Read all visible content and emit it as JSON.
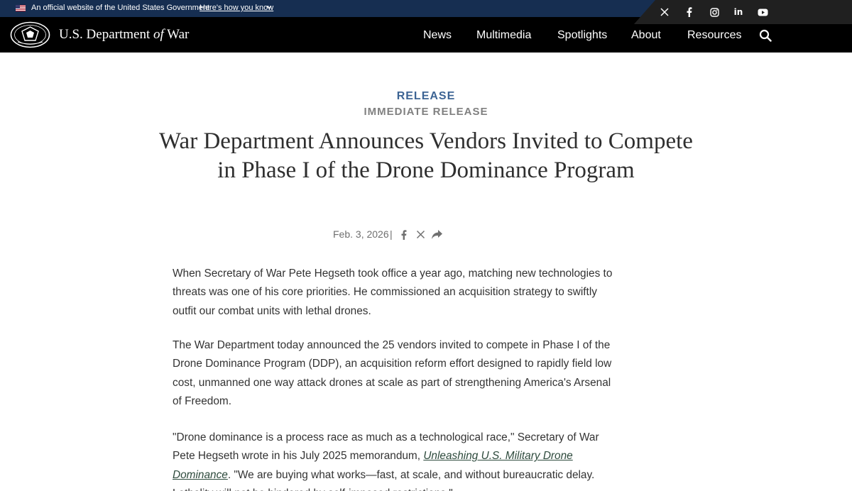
{
  "gov_banner": {
    "text": "An official website of the United States Government",
    "link": "Here's how you know",
    "flag_icon": "us-flag-icon",
    "chevron_icon": "chevron-down-icon"
  },
  "social": [
    {
      "name": "x",
      "icon": "x-icon"
    },
    {
      "name": "facebook",
      "icon": "facebook-icon"
    },
    {
      "name": "instagram",
      "icon": "instagram-icon"
    },
    {
      "name": "linkedin",
      "icon": "linkedin-icon",
      "glyph": "in"
    },
    {
      "name": "youtube",
      "icon": "youtube-icon"
    }
  ],
  "header": {
    "title_part1": "U.S. Department ",
    "title_of": "of",
    "title_part2": " War",
    "nav": [
      "News",
      "Multimedia",
      "Spotlights",
      "About",
      "Resources"
    ],
    "search_icon": "search-icon"
  },
  "article": {
    "category": "RELEASE",
    "subcategory": "IMMEDIATE RELEASE",
    "headline": "War Department Announces Vendors Invited to Compete in Phase I of the Drone Dominance Program",
    "date": "Feb. 3, 2026",
    "separator": "|",
    "share_icons": [
      "facebook-icon",
      "x-icon",
      "share-forward-icon"
    ],
    "paragraphs": [
      "When Secretary of War Pete Hegseth took office a year ago, matching new technologies to threats was one of his core priorities. He commissioned an acquisition strategy to swiftly outfit our combat units with lethal drones.",
      "The War Department today announced the 25 vendors invited to compete in Phase I of the Drone Dominance Program (DDP), an acquisition reform effort designed to rapidly field low cost, unmanned one way attack drones at scale as part of strengthening America's Arsenal of Freedom."
    ],
    "quote_before": "\"Drone dominance is a process race as much as a technological race,\" Secretary of War Pete Hegseth wrote in his July 2025 memorandum, ",
    "quote_link": "Unleashing U.S. Military Drone Dominance",
    "quote_after": ". \"We are buying what works—fast, at scale, and without bureaucratic delay. Lethality will not be hindered by self-imposed restrictions.\""
  },
  "colors": {
    "gov_banner_bg": "#162e51",
    "header_bg": "#000000",
    "category": "#3d6494",
    "subcategory": "#808080",
    "link": "#2d4a3c"
  }
}
